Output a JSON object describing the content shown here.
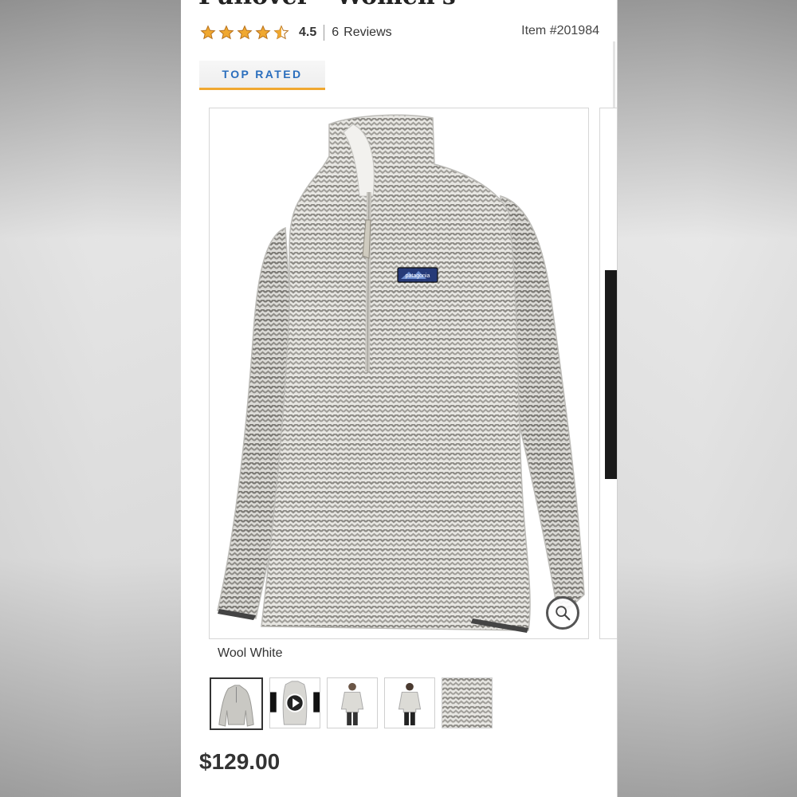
{
  "product": {
    "title_partial": "Pullover - Women's",
    "rating_value": "4.5",
    "rating_stars": 4.5,
    "review_count": "6",
    "reviews_label": "Reviews",
    "item_number": "Item #201984",
    "badge": "TOP RATED",
    "color_name": "Wool White",
    "price": "$129.00",
    "brand_patch": "patagonia"
  },
  "gallery": {
    "thumbnails": [
      {
        "kind": "front-view",
        "active": true
      },
      {
        "kind": "video",
        "active": false
      },
      {
        "kind": "model-front",
        "active": false
      },
      {
        "kind": "model-back",
        "active": false
      },
      {
        "kind": "fabric-detail",
        "active": false
      }
    ]
  },
  "icons": {
    "zoom": "magnifier-icon",
    "star": "star-icon",
    "play": "play-icon"
  },
  "colors": {
    "star_fill": "#f0a830",
    "badge_text": "#2a6ebd",
    "badge_underline": "#f0a830",
    "price_text": "#333333"
  }
}
